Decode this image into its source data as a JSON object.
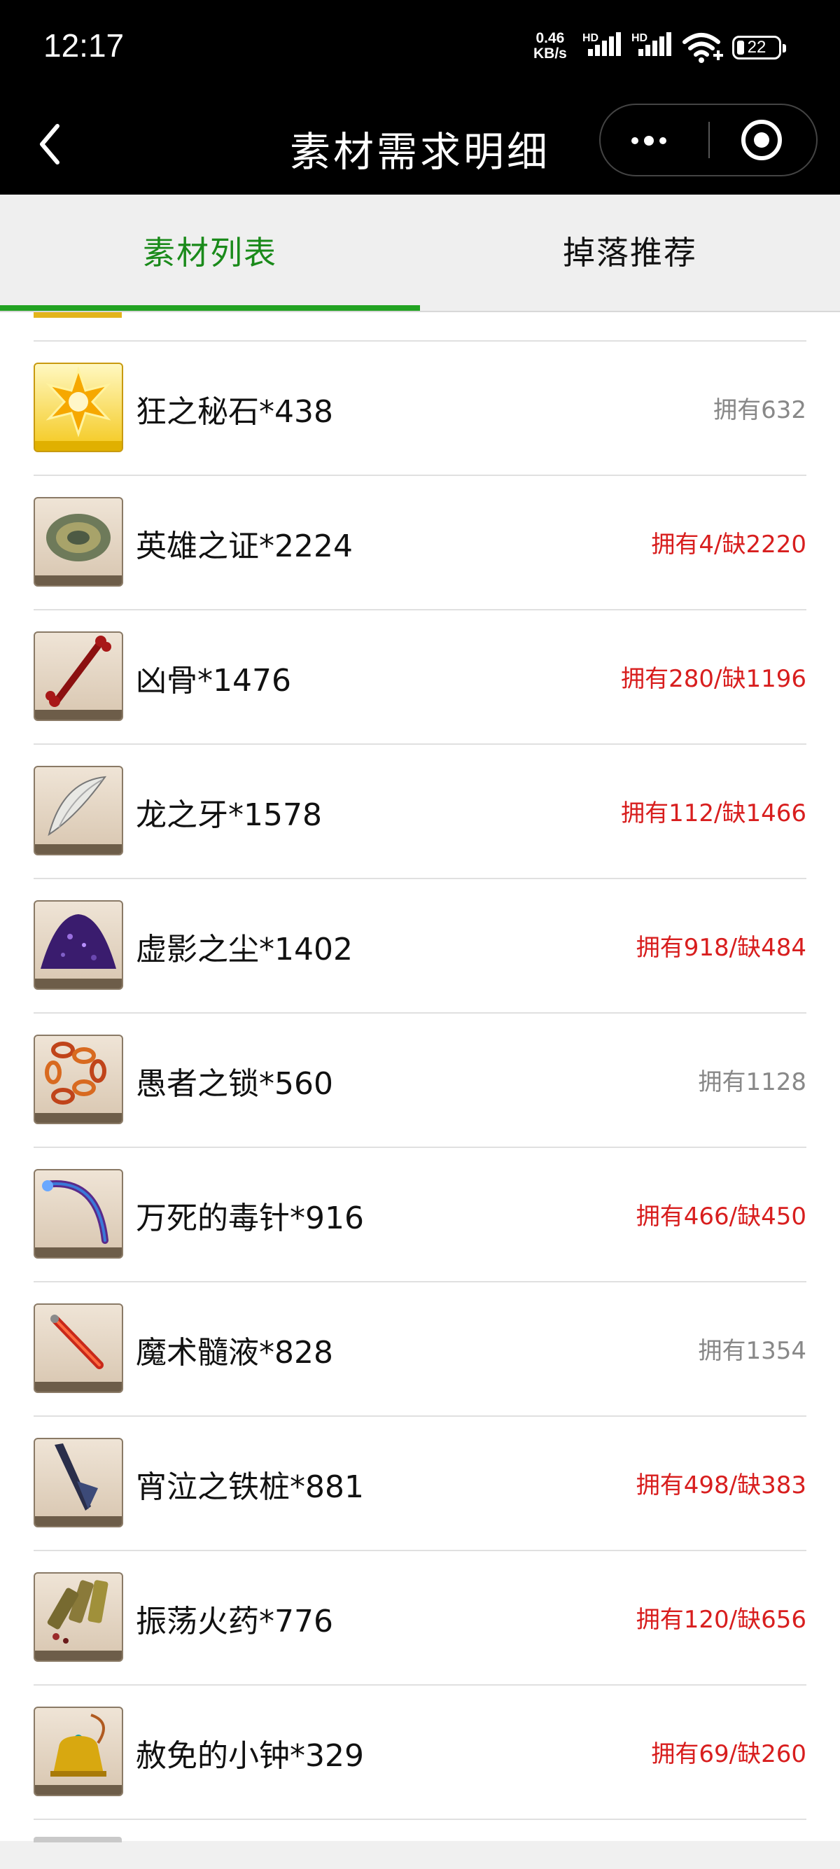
{
  "status_bar": {
    "time": "12:17",
    "net_speed_value": "0.46",
    "net_speed_unit": "KB/s",
    "hd1": "HD",
    "hd2": "HD",
    "battery": "22"
  },
  "nav": {
    "title": "素材需求明细"
  },
  "tabs": [
    {
      "label": "素材列表",
      "active": true
    },
    {
      "label": "掉落推荐",
      "active": false
    }
  ],
  "items": [
    {
      "name": "狂之秘石*438",
      "status": "拥有632",
      "short": false,
      "icon": "gold-star-gem-icon"
    },
    {
      "name": "英雄之证*2224",
      "status": "拥有4/缺2220",
      "short": true,
      "icon": "bronze-medal-icon"
    },
    {
      "name": "凶骨*1476",
      "status": "拥有280/缺1196",
      "short": true,
      "icon": "red-bone-icon"
    },
    {
      "name": "龙之牙*1578",
      "status": "拥有112/缺1466",
      "short": true,
      "icon": "dragon-fang-icon"
    },
    {
      "name": "虚影之尘*1402",
      "status": "拥有918/缺484",
      "short": true,
      "icon": "purple-dust-icon"
    },
    {
      "name": "愚者之锁*560",
      "status": "拥有1128",
      "short": false,
      "icon": "chain-icon"
    },
    {
      "name": "万死的毒针*916",
      "status": "拥有466/缺450",
      "short": true,
      "icon": "poison-needle-icon"
    },
    {
      "name": "魔术髓液*828",
      "status": "拥有1354",
      "short": false,
      "icon": "red-vial-icon"
    },
    {
      "name": "宵泣之铁桩*881",
      "status": "拥有498/缺383",
      "short": true,
      "icon": "iron-stake-icon"
    },
    {
      "name": "振荡火药*776",
      "status": "拥有120/缺656",
      "short": true,
      "icon": "gunpowder-shells-icon"
    },
    {
      "name": "赦免的小钟*329",
      "status": "拥有69/缺260",
      "short": true,
      "icon": "golden-bell-icon"
    }
  ]
}
